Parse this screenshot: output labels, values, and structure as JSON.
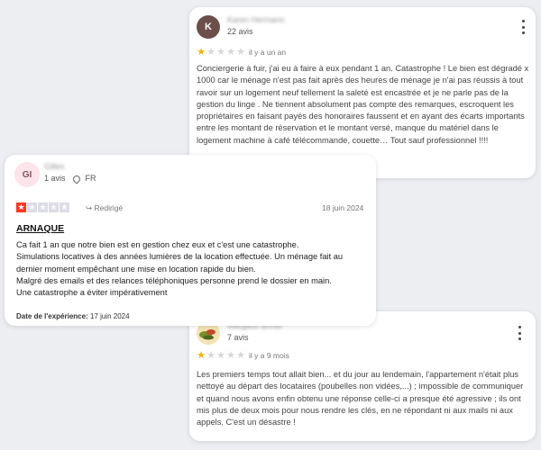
{
  "review_karen": {
    "avatar_letter": "K",
    "name": "Karen Hermann",
    "reviews_count": "22 avis",
    "rating": 1,
    "time_ago": "il y a un an",
    "body": "Conciergerie à fuir, j'ai eu à faire à eux pendant 1 an. Catastrophe ! Le bien est dégradé x 1000 car le ménage n'est pas fait après des heures de ménage je n'ai pas réussis à tout ravoir sur un logement neuf tellement la saleté est encastrée et je ne parle pas de la gestion du linge . Ne tiennent absolument pas compte des remarques, escroquent les propriétaires en faisant payés des honoraires faussent et en ayant des écarts importants entre les montant de réservation et le montant versé, manque du matériel dans le logement machine à café télécommande, couette… Tout sauf professionnel !!!!"
  },
  "review_gilles": {
    "avatar_initials": "GI",
    "name": "Gilles",
    "reviews_count": "1 avis",
    "country": "FR",
    "rating": 1,
    "redirect_label": "Redirigé",
    "date": "18 juin 2024",
    "title": "ARNAQUE",
    "body": "Ca fait 1 an que notre bien est en gestion chez eux et c'est une catastrophe.\nSimulations locatives à des années lumières de la location effectuée. Un ménage fait au dernier moment empêchant une mise en location rapide du bien.\nMalgré des emails et des relances téléphoniques personne prend le dossier en main.\nUne catastrophe a éviter impérativement",
    "experience_label": "Date de l'expérience:",
    "experience_date": "17 juin 2024"
  },
  "review_margaux": {
    "name": "Margaux Brinet",
    "reviews_count": "7 avis",
    "rating": 1,
    "time_ago": "il y a 9 mois",
    "body": "Les premiers temps tout allait bien... et du jour au lendemain, l'appartement n'était plus nettoyé au départ des locataires (poubelles non vidées,...) ; impossible de communiquer et quand nous avons enfin obtenu une réponse celle-ci a presque été agressive ; ils ont mis plus de deux mois pour nous rendre les clés, en ne répondant ni aux mails ni aux appels. C'est un désastre !"
  },
  "colors": {
    "trustpilot_red": "#ff3722",
    "google_star": "#f4b400",
    "avatar_k": "#6b4f4a",
    "avatar_gi": "#fbe4ea"
  },
  "icons": {
    "kebab": "kebab-menu-icon",
    "redirect": "redirect-arrow-icon",
    "location": "location-pin-icon",
    "star": "star-icon"
  }
}
